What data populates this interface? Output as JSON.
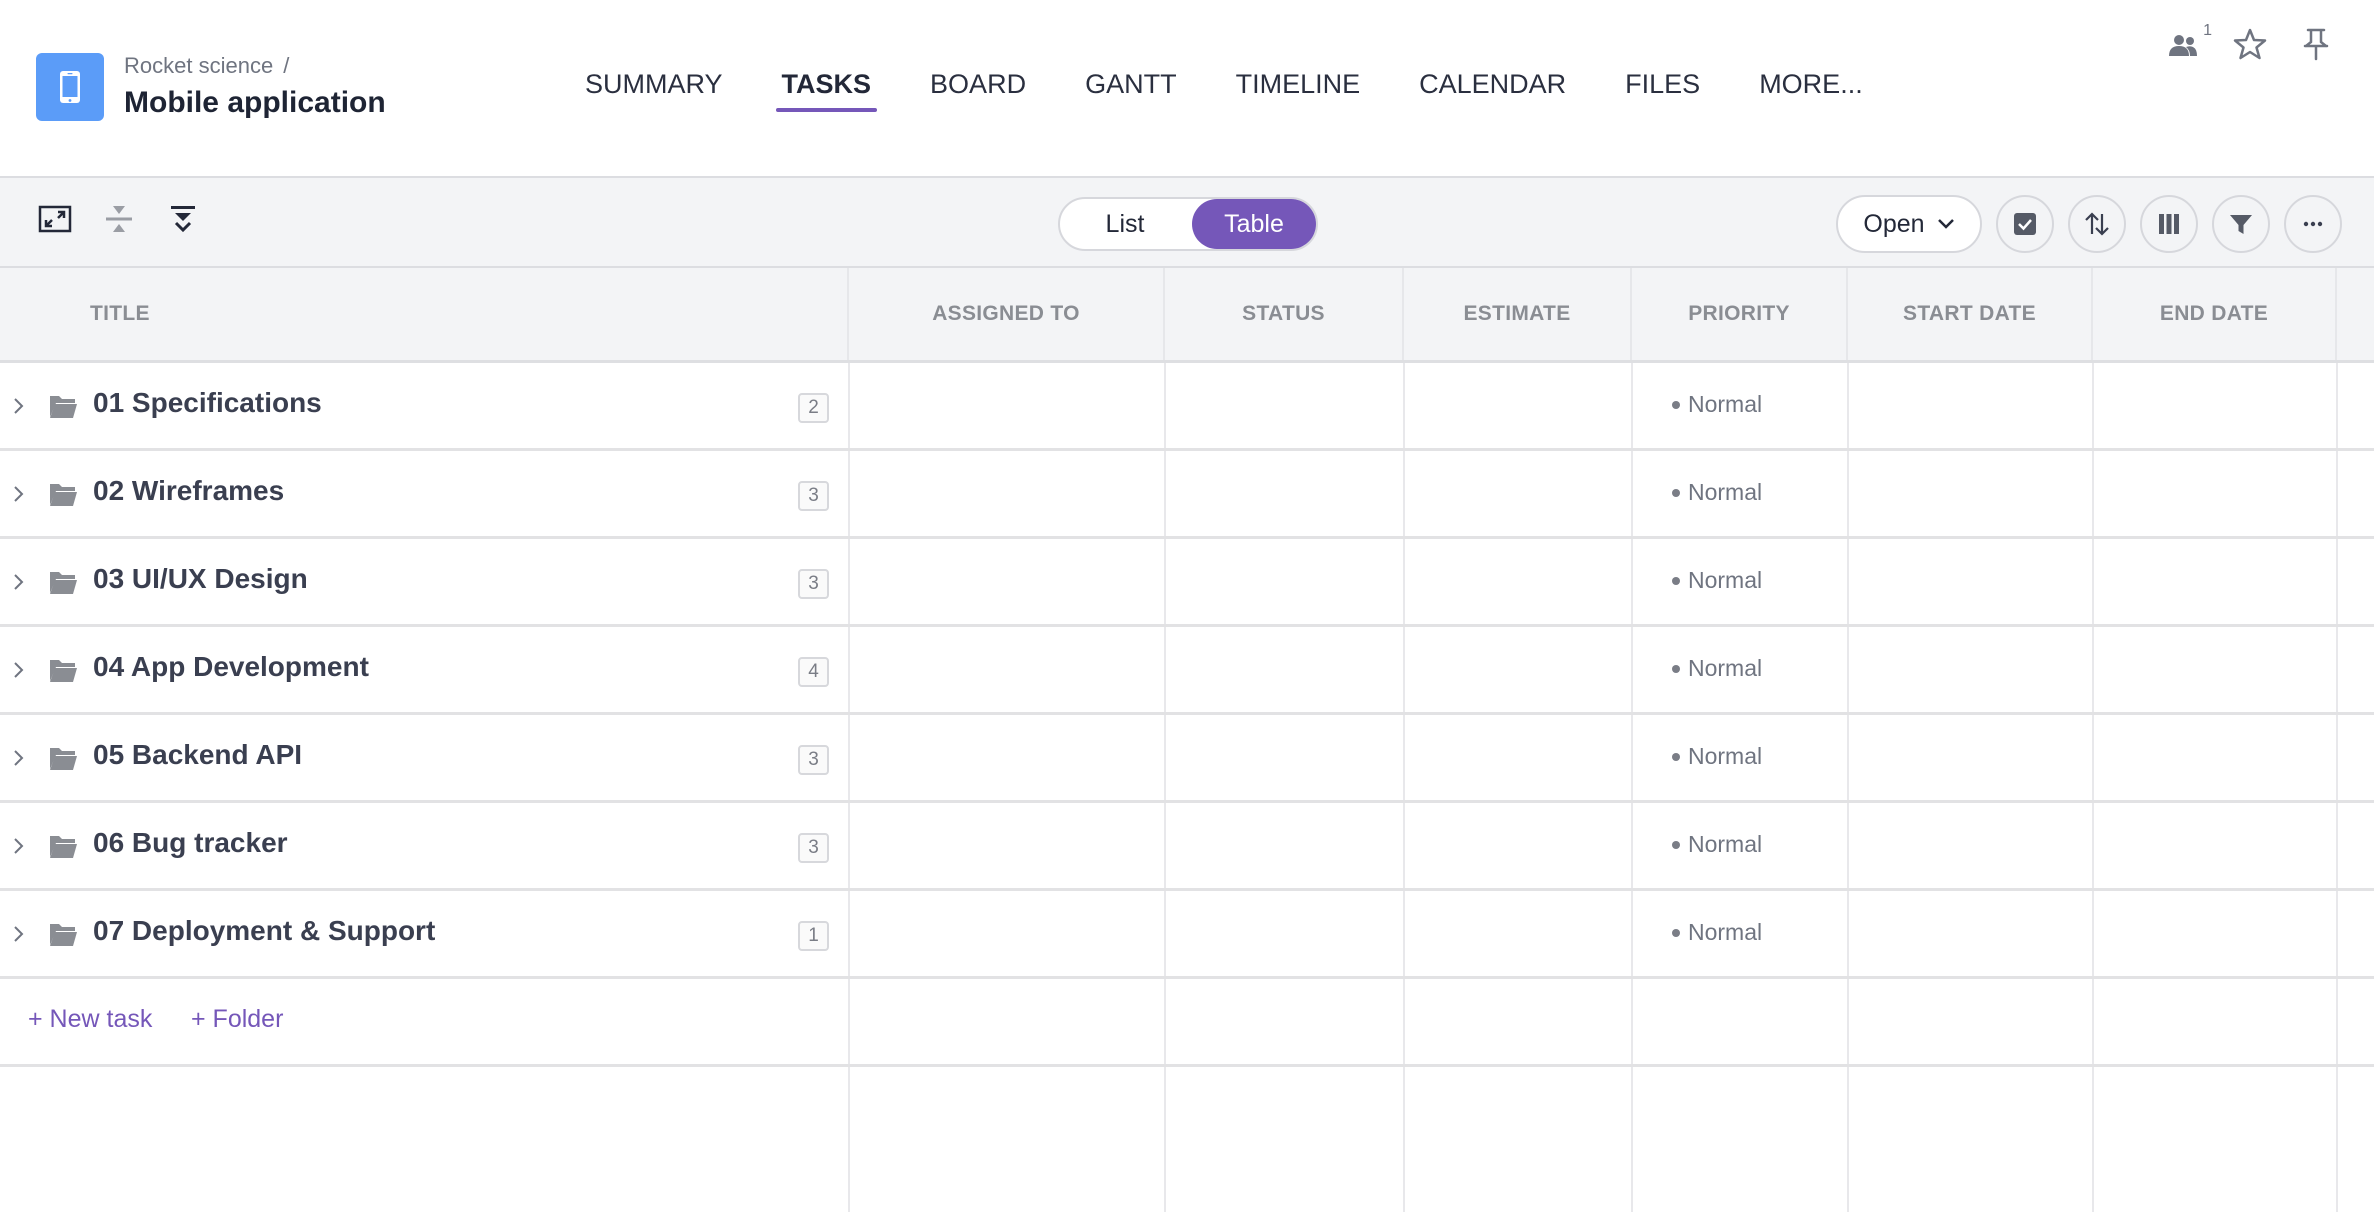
{
  "header": {
    "breadcrumb_parent": "Rocket science",
    "breadcrumb_separator": "/",
    "project_title": "Mobile application",
    "app_icon": "mobile-phone-icon",
    "app_icon_color": "#5b9cf8",
    "tabs": [
      {
        "label": "SUMMARY",
        "active": false
      },
      {
        "label": "TASKS",
        "active": true
      },
      {
        "label": "BOARD",
        "active": false
      },
      {
        "label": "GANTT",
        "active": false
      },
      {
        "label": "TIMELINE",
        "active": false
      },
      {
        "label": "CALENDAR",
        "active": false
      },
      {
        "label": "FILES",
        "active": false
      },
      {
        "label": "MORE...",
        "active": false
      }
    ],
    "members_count": "1",
    "actions": [
      "members-icon",
      "star-icon",
      "pin-icon"
    ]
  },
  "toolbar": {
    "left_icons": [
      "expand-icon",
      "collapse-rows-icon",
      "expand-all-icon"
    ],
    "view_toggle": {
      "options": [
        "List",
        "Table"
      ],
      "selected": "Table"
    },
    "status_filter": "Open",
    "right_icons": [
      "checkbox-icon",
      "sort-icon",
      "columns-icon",
      "filter-icon",
      "more-icon"
    ]
  },
  "table": {
    "columns": [
      "TITLE",
      "ASSIGNED TO",
      "STATUS",
      "ESTIMATE",
      "PRIORITY",
      "START DATE",
      "END DATE"
    ],
    "rows": [
      {
        "title": "01 Specifications",
        "count": "2",
        "assigned_to": "",
        "status": "",
        "estimate": "",
        "priority": "Normal",
        "start_date": "",
        "end_date": ""
      },
      {
        "title": "02 Wireframes",
        "count": "3",
        "assigned_to": "",
        "status": "",
        "estimate": "",
        "priority": "Normal",
        "start_date": "",
        "end_date": ""
      },
      {
        "title": "03 UI/UX Design",
        "count": "3",
        "assigned_to": "",
        "status": "",
        "estimate": "",
        "priority": "Normal",
        "start_date": "",
        "end_date": ""
      },
      {
        "title": "04 App Development",
        "count": "4",
        "assigned_to": "",
        "status": "",
        "estimate": "",
        "priority": "Normal",
        "start_date": "",
        "end_date": ""
      },
      {
        "title": "05 Backend API",
        "count": "3",
        "assigned_to": "",
        "status": "",
        "estimate": "",
        "priority": "Normal",
        "start_date": "",
        "end_date": ""
      },
      {
        "title": "06 Bug tracker",
        "count": "3",
        "assigned_to": "",
        "status": "",
        "estimate": "",
        "priority": "Normal",
        "start_date": "",
        "end_date": ""
      },
      {
        "title": "07 Deployment & Support",
        "count": "1",
        "assigned_to": "",
        "status": "",
        "estimate": "",
        "priority": "Normal",
        "start_date": "",
        "end_date": ""
      }
    ],
    "add_task_label": "+ New task",
    "add_folder_label": "+ Folder"
  },
  "colors": {
    "accent": "#7557b9",
    "app_icon": "#5b9cf8",
    "toolbar_bg": "#f3f4f6",
    "text_dark": "#232838"
  }
}
